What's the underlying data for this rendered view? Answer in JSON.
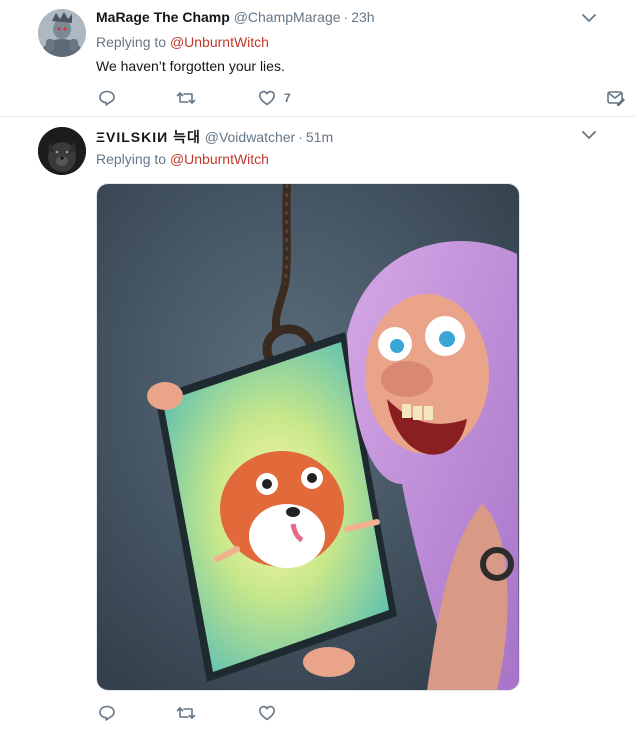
{
  "tweets": [
    {
      "fullname": "MaRage The Champ",
      "handle": "@ChampMarage",
      "time": "23h",
      "replying_label": "Replying to ",
      "replying_to": "@UnburntWitch",
      "text": "We haven’t forgotten your lies.",
      "like_count": "7",
      "actions": [
        "reply-icon",
        "retweet-icon",
        "heart-icon",
        "direct-message-icon"
      ]
    },
    {
      "fullname": "ΞVILSKIИ 늑대",
      "handle": "@Voidwatcher",
      "time": "51m",
      "replying_label": "Replying to ",
      "replying_to": "@UnburntWitch",
      "media": "illustration of a purple-haired woman holding a framed picture of a fluffy orange dog, with a noose hanging above",
      "actions": [
        "reply-icon",
        "retweet-icon",
        "heart-icon"
      ]
    }
  ],
  "separator": "·",
  "colors": {
    "accent_red": "#c0392b",
    "muted": "#657786",
    "text": "#14171a",
    "border": "#e6ecf0"
  }
}
